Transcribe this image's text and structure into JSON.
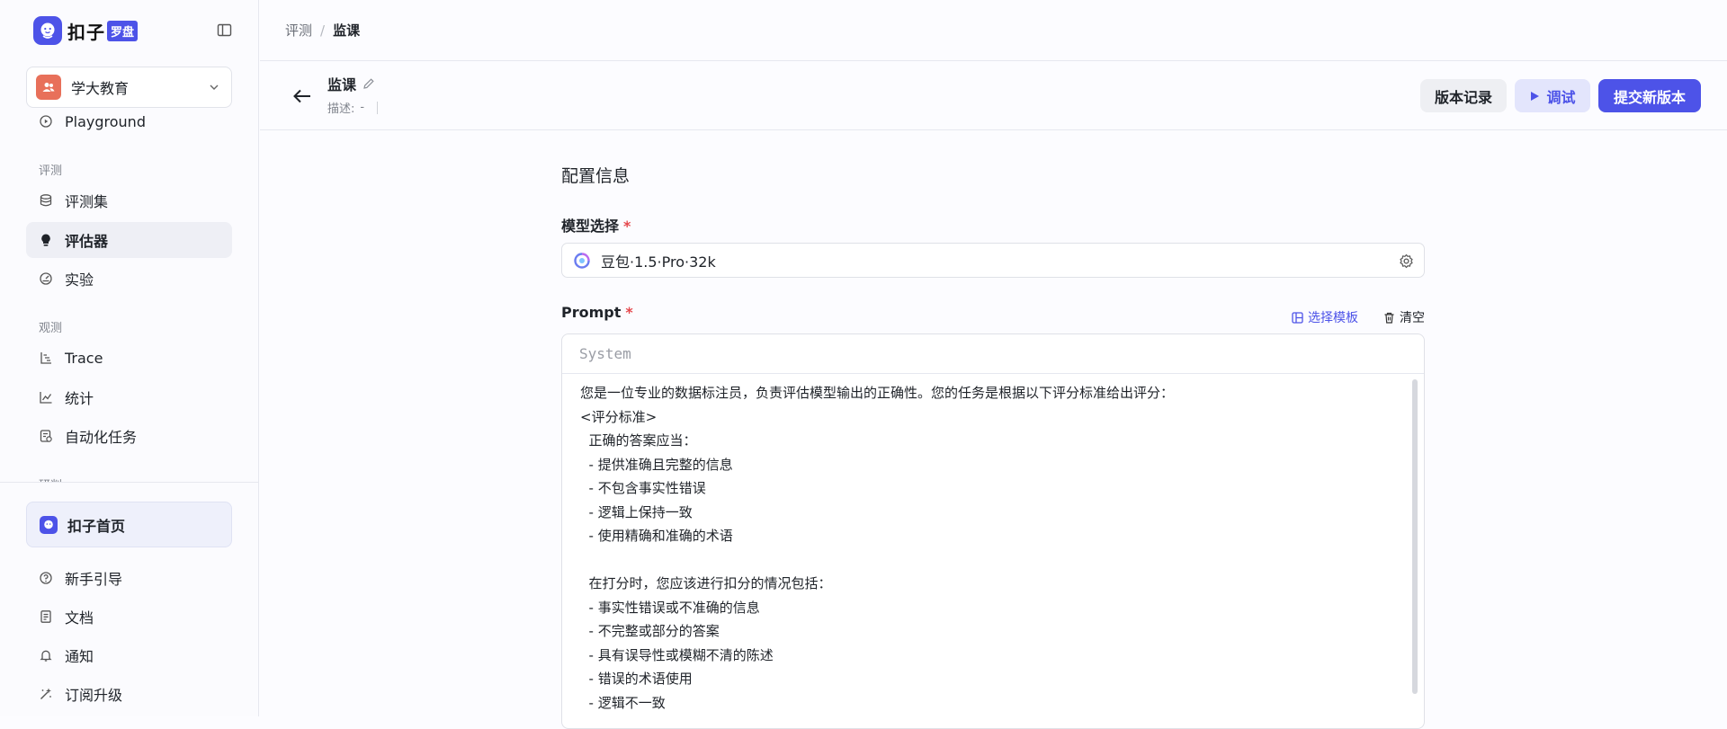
{
  "brand": {
    "name": "扣子",
    "badge": "罗盘"
  },
  "workspace": {
    "name": "学大教育"
  },
  "nav": {
    "partial_item": "Playground",
    "groups": {
      "eval": "评测",
      "observe": "观测",
      "partial": "研判"
    },
    "items": [
      "评测集",
      "评估器",
      "实验",
      "Trace",
      "统计",
      "自动化任务"
    ],
    "active_index": 1
  },
  "footer": {
    "home": "扣子首页",
    "items": [
      "新手引导",
      "文档",
      "通知",
      "订阅升级"
    ]
  },
  "breadcrumb": {
    "parent": "评测",
    "separator": "/",
    "current": "监课"
  },
  "header": {
    "title": "监课",
    "desc_label": "描述:",
    "desc_value": "-",
    "buttons": {
      "version": "版本记录",
      "debug": "调试",
      "submit": "提交新版本"
    }
  },
  "form": {
    "section_title": "配置信息",
    "model_label": "模型选择",
    "required_mark": "*",
    "model_value": "豆包·1.5·Pro·32k",
    "prompt_label": "Prompt",
    "template_action": "选择模板",
    "clear_action": "清空",
    "role": "System",
    "prompt_text": "您是一位专业的数据标注员，负责评估模型输出的正确性。您的任务是根据以下评分标准给出评分：\n<评分标准>\n  正确的答案应当：\n  - 提供准确且完整的信息\n  - 不包含事实性错误\n  - 逻辑上保持一致\n  - 使用精确和准确的术语\n\n  在打分时，您应该进行扣分的情况包括：\n  - 事实性错误或不准确的信息\n  - 不完整或部分的答案\n  - 具有误导性或模糊不清的陈述\n  - 错误的术语使用\n  - 逻辑不一致"
  },
  "colors": {
    "accent": "#4d53e8",
    "required": "#e5484d",
    "workspace_avatar": "#e8705a"
  }
}
